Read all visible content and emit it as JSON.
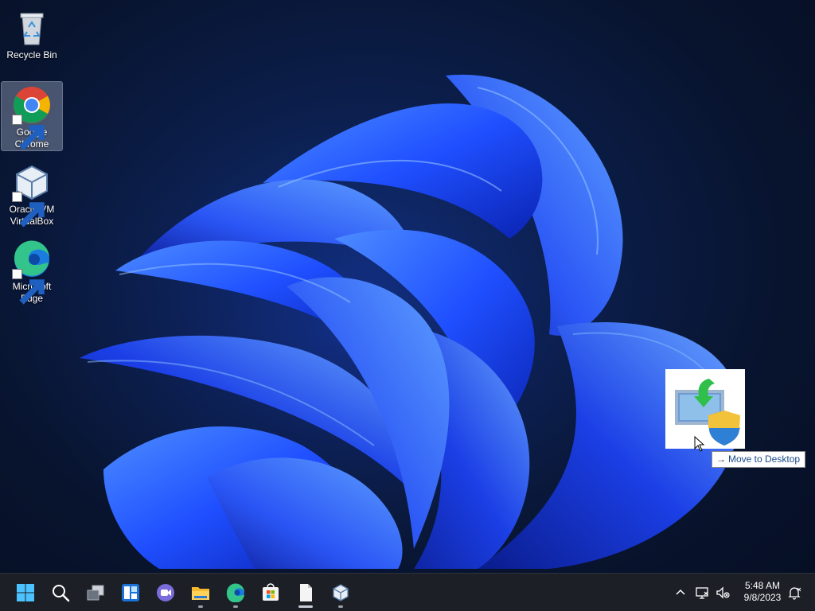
{
  "desktop": {
    "icons": [
      {
        "label": "Recycle Bin",
        "icon": "recycle-bin-icon",
        "selected": false
      },
      {
        "label": "Google Chrome",
        "icon": "chrome-icon",
        "selected": true
      },
      {
        "label": "Oracle VM VirtualBox",
        "icon": "virtualbox-icon",
        "selected": false
      },
      {
        "label": "Microsoft Edge",
        "icon": "edge-icon",
        "selected": false
      }
    ],
    "drag": {
      "icon": "monitor-shield-icon",
      "tooltip_arrow": "→",
      "tooltip_label": "Move to Desktop"
    }
  },
  "taskbar": {
    "apps": [
      {
        "name": "Start",
        "icon": "windows-start-icon"
      },
      {
        "name": "Search",
        "icon": "search-icon"
      },
      {
        "name": "Task View",
        "icon": "task-view-icon"
      },
      {
        "name": "Widgets",
        "icon": "widgets-icon"
      },
      {
        "name": "Chat",
        "icon": "chat-icon"
      },
      {
        "name": "File Explorer",
        "icon": "file-explorer-icon"
      },
      {
        "name": "Microsoft Edge",
        "icon": "edge-icon"
      },
      {
        "name": "Microsoft Store",
        "icon": "store-icon"
      },
      {
        "name": "Notepad",
        "icon": "notepad-icon"
      },
      {
        "name": "Oracle VM VirtualBox",
        "icon": "virtualbox-icon"
      }
    ],
    "tray": {
      "icons": [
        "chevron-up-icon",
        "network-icon",
        "volume-muted-icon",
        "notification-icon"
      ],
      "time": "5:48 AM",
      "date": "9/8/2023"
    }
  },
  "colors": {
    "accent": "#1f5fff",
    "taskbar_bg": "#1c1f26",
    "tooltip_text": "#1a4a8a"
  }
}
